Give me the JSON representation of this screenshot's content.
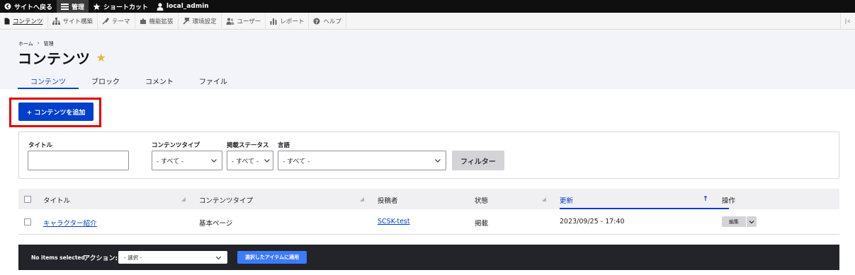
{
  "toolbar": {
    "back_to_site": "サイトへ戻る",
    "manage": "管理",
    "shortcuts": "ショートカット",
    "user": "local_admin"
  },
  "tray": {
    "items": [
      "コンテンツ",
      "サイト構築",
      "テーマ",
      "機能拡張",
      "環境設定",
      "ユーザー",
      "レポート",
      "ヘルプ"
    ]
  },
  "breadcrumb": {
    "home": "ホーム",
    "separator": "›",
    "manage": "管理"
  },
  "page": {
    "title": "コンテンツ",
    "star": "★"
  },
  "tabs": [
    "コンテンツ",
    "ブロック",
    "コメント",
    "ファイル"
  ],
  "add_button": "+ コンテンツを追加",
  "filters": {
    "title_label": "タイトル",
    "title_value": "",
    "type_label": "コンテンツタイプ",
    "type_value": "- すべて -",
    "status_label": "掲載ステータス",
    "status_value": "- すべて -",
    "lang_label": "言語",
    "lang_value": "- すべて -",
    "submit": "フィルター"
  },
  "table": {
    "headers": [
      "タイトル",
      "コンテンツタイプ",
      "投稿者",
      "状態",
      "更新",
      "操作"
    ],
    "sort_icon": "↑",
    "rows": [
      {
        "title": "キャラクター紹介",
        "type": "基本ページ",
        "author": "SCSK-test",
        "status": "掲載",
        "updated": "2023/09/25 - 17:40",
        "op": "編集"
      }
    ]
  },
  "bulk": {
    "no_items": "No items selected",
    "action_label": "アクション:",
    "select_value": "- 選択 -",
    "apply": "選択したアイテムに適用"
  },
  "colors": {
    "accent": "#003ecc",
    "highlight": "#e00000"
  }
}
